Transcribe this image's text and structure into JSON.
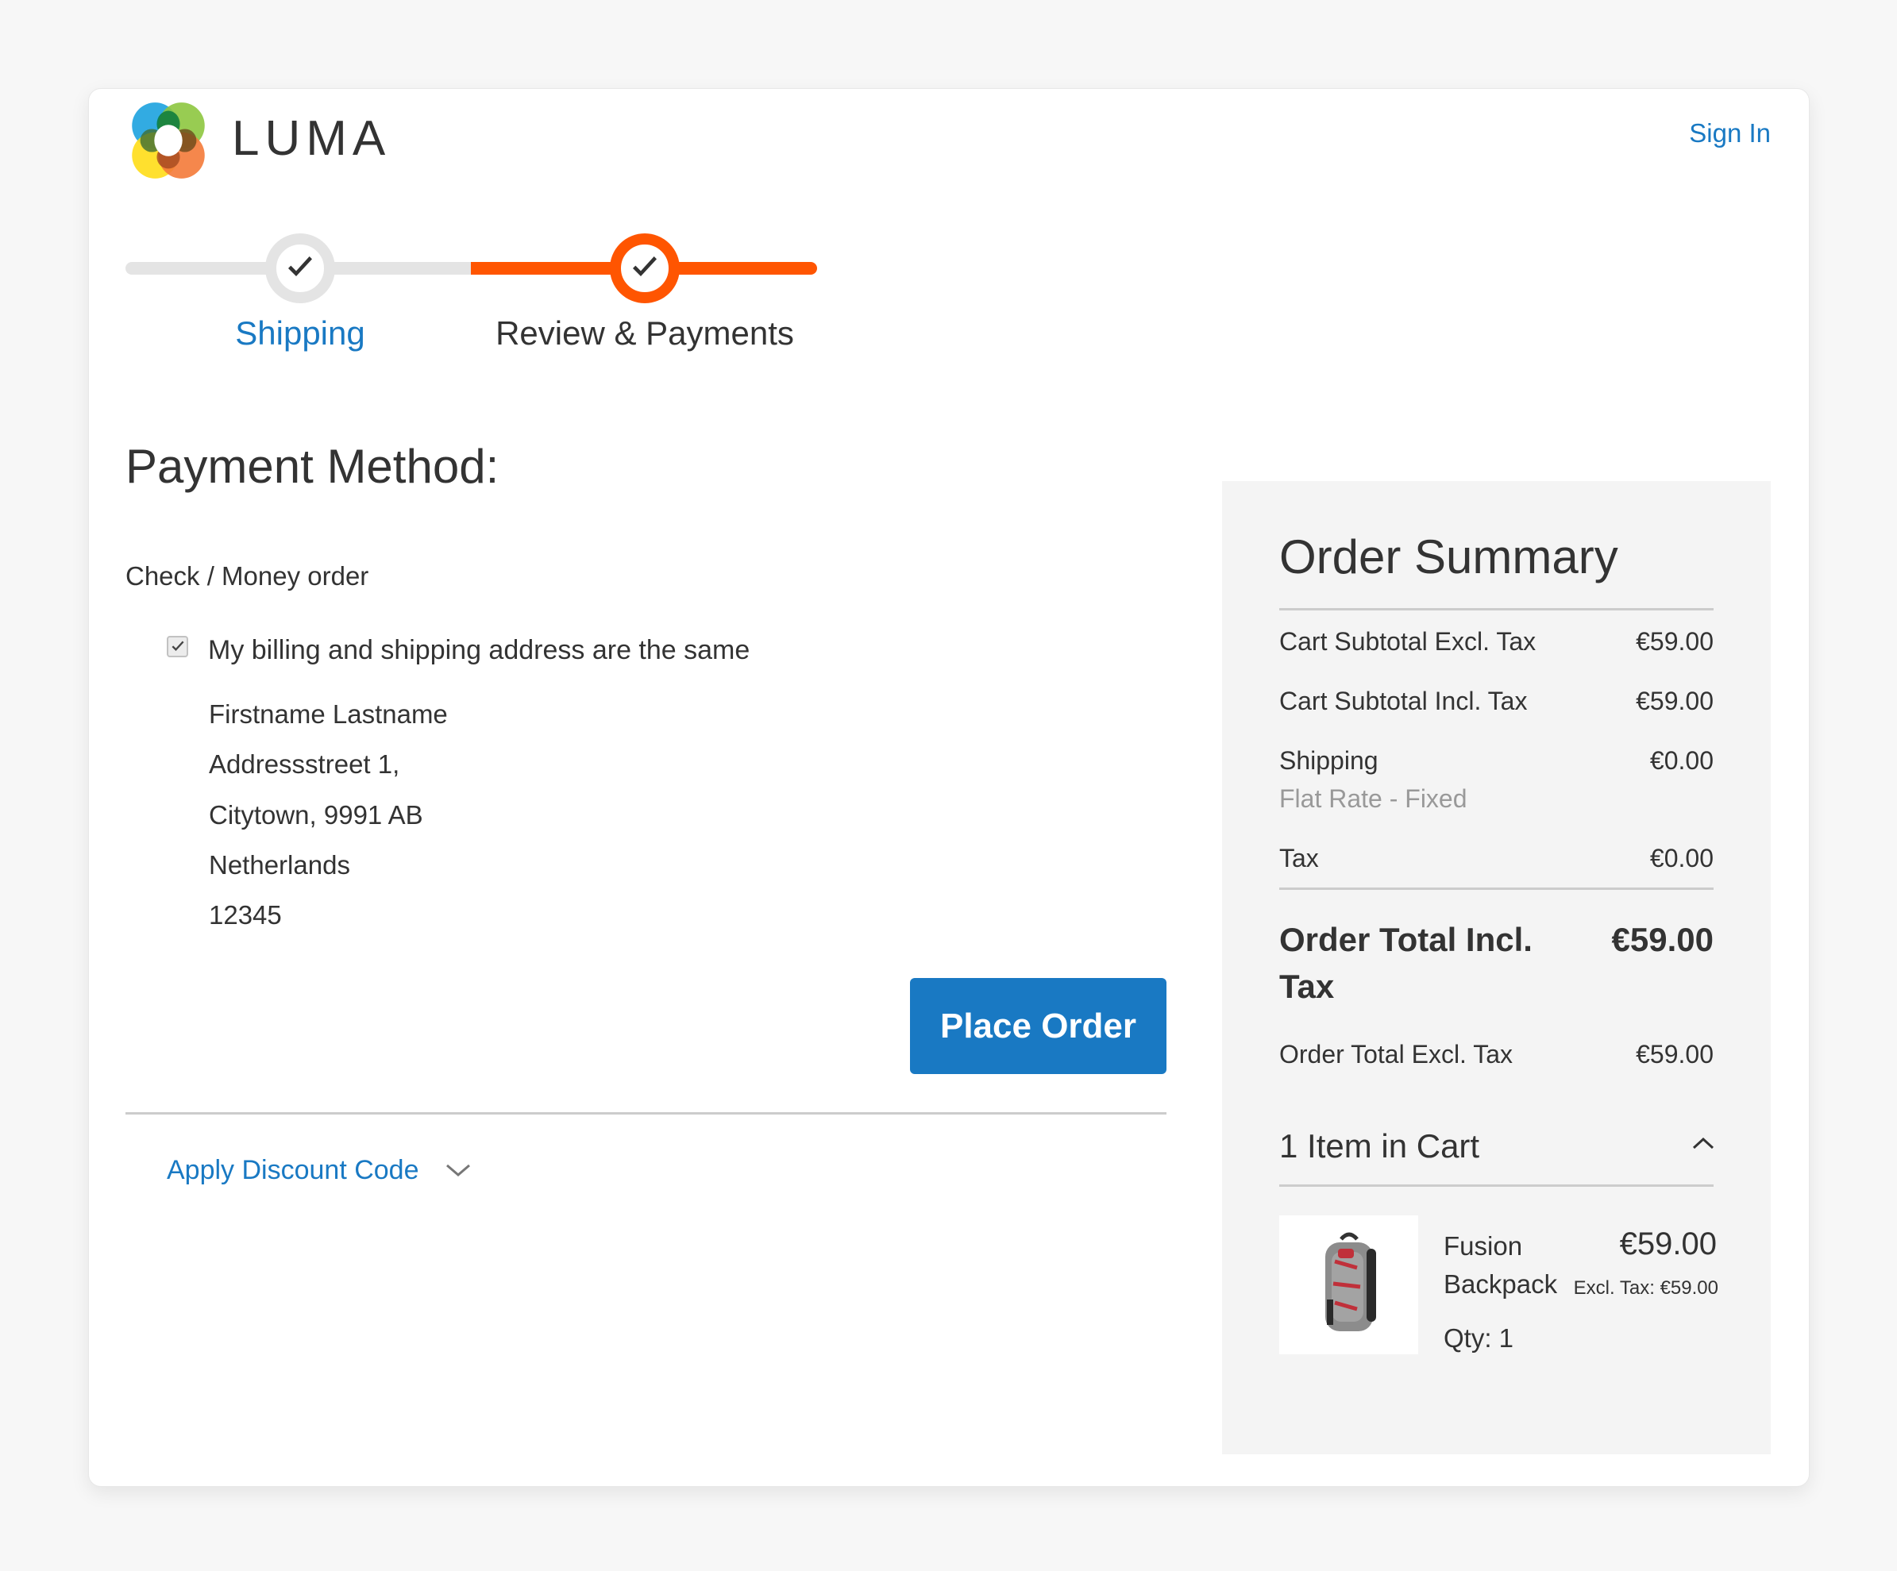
{
  "header": {
    "brand": "LUMA",
    "logo_icon": "luma-logo-icon",
    "sign_in": "Sign In"
  },
  "progress": {
    "steps": [
      {
        "label": "Shipping",
        "state": "complete",
        "link": true
      },
      {
        "label": "Review & Payments",
        "state": "active"
      }
    ],
    "check_icon": "checkmark-icon",
    "colors": {
      "active": "#ff5501",
      "inactive": "#e4e4e4",
      "link": "#1979c3"
    }
  },
  "payment": {
    "title": "Payment Method:",
    "method": "Check / Money order",
    "same_address_label": "My billing and shipping address are the same",
    "same_address_checked": true,
    "address": [
      "Firstname Lastname",
      "Addressstreet 1,",
      "Citytown, 9991 AB",
      "Netherlands",
      "12345"
    ],
    "place_order": "Place Order",
    "discount_label": "Apply Discount Code",
    "discount_icon": "chevron-down-icon",
    "button_color": "#1979c3"
  },
  "summary": {
    "title": "Order Summary",
    "rows": [
      {
        "label": "Cart Subtotal Excl. Tax",
        "value": "€59.00"
      },
      {
        "label": "Cart Subtotal Incl. Tax",
        "value": "€59.00"
      },
      {
        "label": "Shipping",
        "value": "€0.00",
        "sub": "Flat Rate - Fixed"
      },
      {
        "label": "Tax",
        "value": "€0.00"
      }
    ],
    "total_incl": {
      "label_line1": "Order Total Incl.",
      "label_line2": "Tax",
      "value": "€59.00"
    },
    "total_excl": {
      "label": "Order Total Excl. Tax",
      "value": "€59.00"
    },
    "cart_count": "1 Item in Cart",
    "cart_toggle_icon": "chevron-up-icon",
    "item": {
      "name_line1": "Fusion",
      "name_line2": "Backpack",
      "price": "€59.00",
      "excl_tax": "Excl. Tax: €59.00",
      "qty": "Qty: 1",
      "image_icon": "backpack-image"
    }
  }
}
